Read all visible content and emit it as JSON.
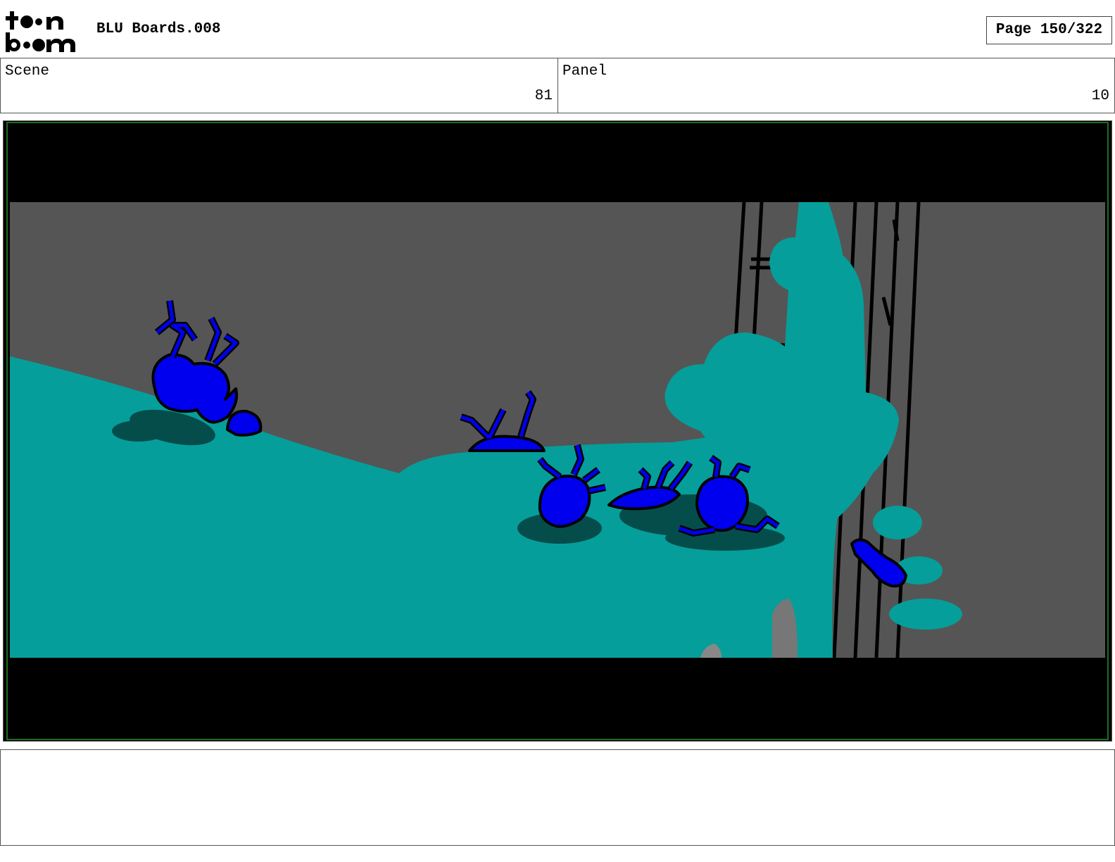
{
  "header": {
    "logo_text": "toon boom",
    "title": "BLU Boards.008",
    "page": "Page 150/322"
  },
  "scene": {
    "label": "Scene",
    "value": "81"
  },
  "panel": {
    "label": "Panel",
    "value": "10"
  },
  "artwork": {
    "colors": {
      "background": "#555555",
      "blob": "#069e9a",
      "shadow": "#054d4b",
      "creatures": "#0000ee",
      "letterbox": "#000000"
    }
  },
  "notes": {
    "text": ""
  }
}
